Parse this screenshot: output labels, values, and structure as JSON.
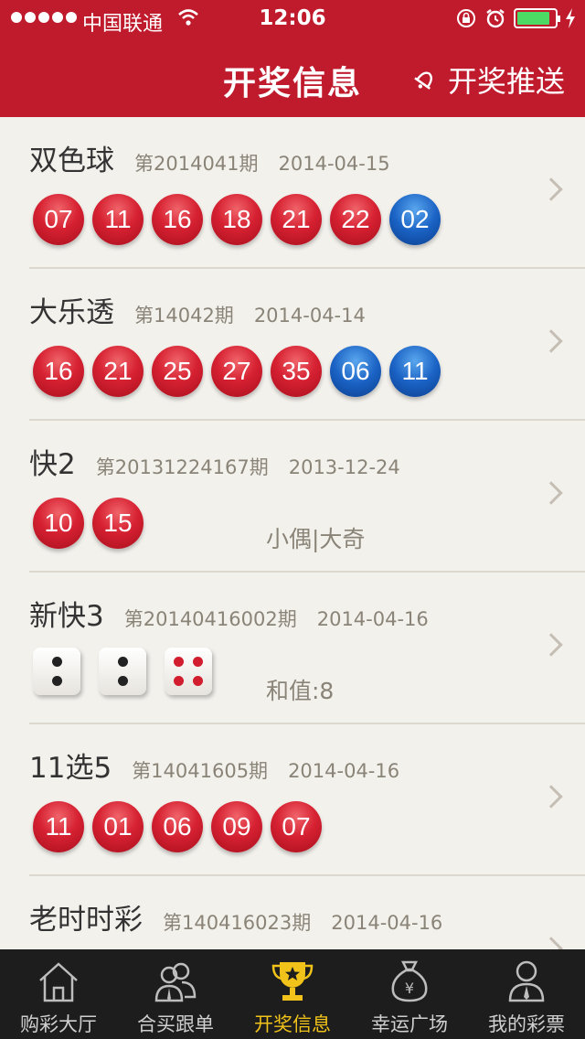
{
  "status_bar": {
    "carrier": "中国联通",
    "time": "12:06",
    "battery_level": 0.88
  },
  "nav": {
    "title": "开奖信息",
    "right_action": "开奖推送"
  },
  "lotteries": [
    {
      "name": "双色球",
      "issue": "第2014041期",
      "date": "2014-04-15",
      "balls": [
        {
          "n": "07",
          "c": "red"
        },
        {
          "n": "11",
          "c": "red"
        },
        {
          "n": "16",
          "c": "red"
        },
        {
          "n": "18",
          "c": "red"
        },
        {
          "n": "21",
          "c": "red"
        },
        {
          "n": "22",
          "c": "red"
        },
        {
          "n": "02",
          "c": "blue"
        }
      ]
    },
    {
      "name": "大乐透",
      "issue": "第14042期",
      "date": "2014-04-14",
      "balls": [
        {
          "n": "16",
          "c": "red"
        },
        {
          "n": "21",
          "c": "red"
        },
        {
          "n": "25",
          "c": "red"
        },
        {
          "n": "27",
          "c": "red"
        },
        {
          "n": "35",
          "c": "red"
        },
        {
          "n": "06",
          "c": "blue"
        },
        {
          "n": "11",
          "c": "blue"
        }
      ]
    },
    {
      "name": "快2",
      "issue": "第20131224167期",
      "date": "2013-12-24",
      "balls": [
        {
          "n": "10",
          "c": "red"
        },
        {
          "n": "15",
          "c": "red"
        }
      ],
      "extra": "小偶|大奇"
    },
    {
      "name": "新快3",
      "issue": "第20140416002期",
      "date": "2014-04-16",
      "dice": [
        2,
        2,
        4
      ],
      "extra": "和值:8"
    },
    {
      "name": "11选5",
      "issue": "第14041605期",
      "date": "2014-04-16",
      "balls": [
        {
          "n": "11",
          "c": "red"
        },
        {
          "n": "01",
          "c": "red"
        },
        {
          "n": "06",
          "c": "red"
        },
        {
          "n": "09",
          "c": "red"
        },
        {
          "n": "07",
          "c": "red"
        }
      ]
    },
    {
      "name": "老时时彩",
      "issue": "第140416023期",
      "date": "2014-04-16"
    }
  ],
  "tabs": [
    {
      "label": "购彩大厅",
      "icon": "home-icon",
      "active": false
    },
    {
      "label": "合买跟单",
      "icon": "group-users-icon",
      "active": false
    },
    {
      "label": "开奖信息",
      "icon": "trophy-star-icon",
      "active": true
    },
    {
      "label": "幸运广场",
      "icon": "money-bag-icon",
      "active": false
    },
    {
      "label": "我的彩票",
      "icon": "user-icon",
      "active": false
    }
  ],
  "colors": {
    "header": "#bf1b2d",
    "ball_red": "#d62132",
    "ball_blue": "#1a62c4",
    "tab_active": "#f0c21a",
    "background": "#f3f1ec"
  }
}
